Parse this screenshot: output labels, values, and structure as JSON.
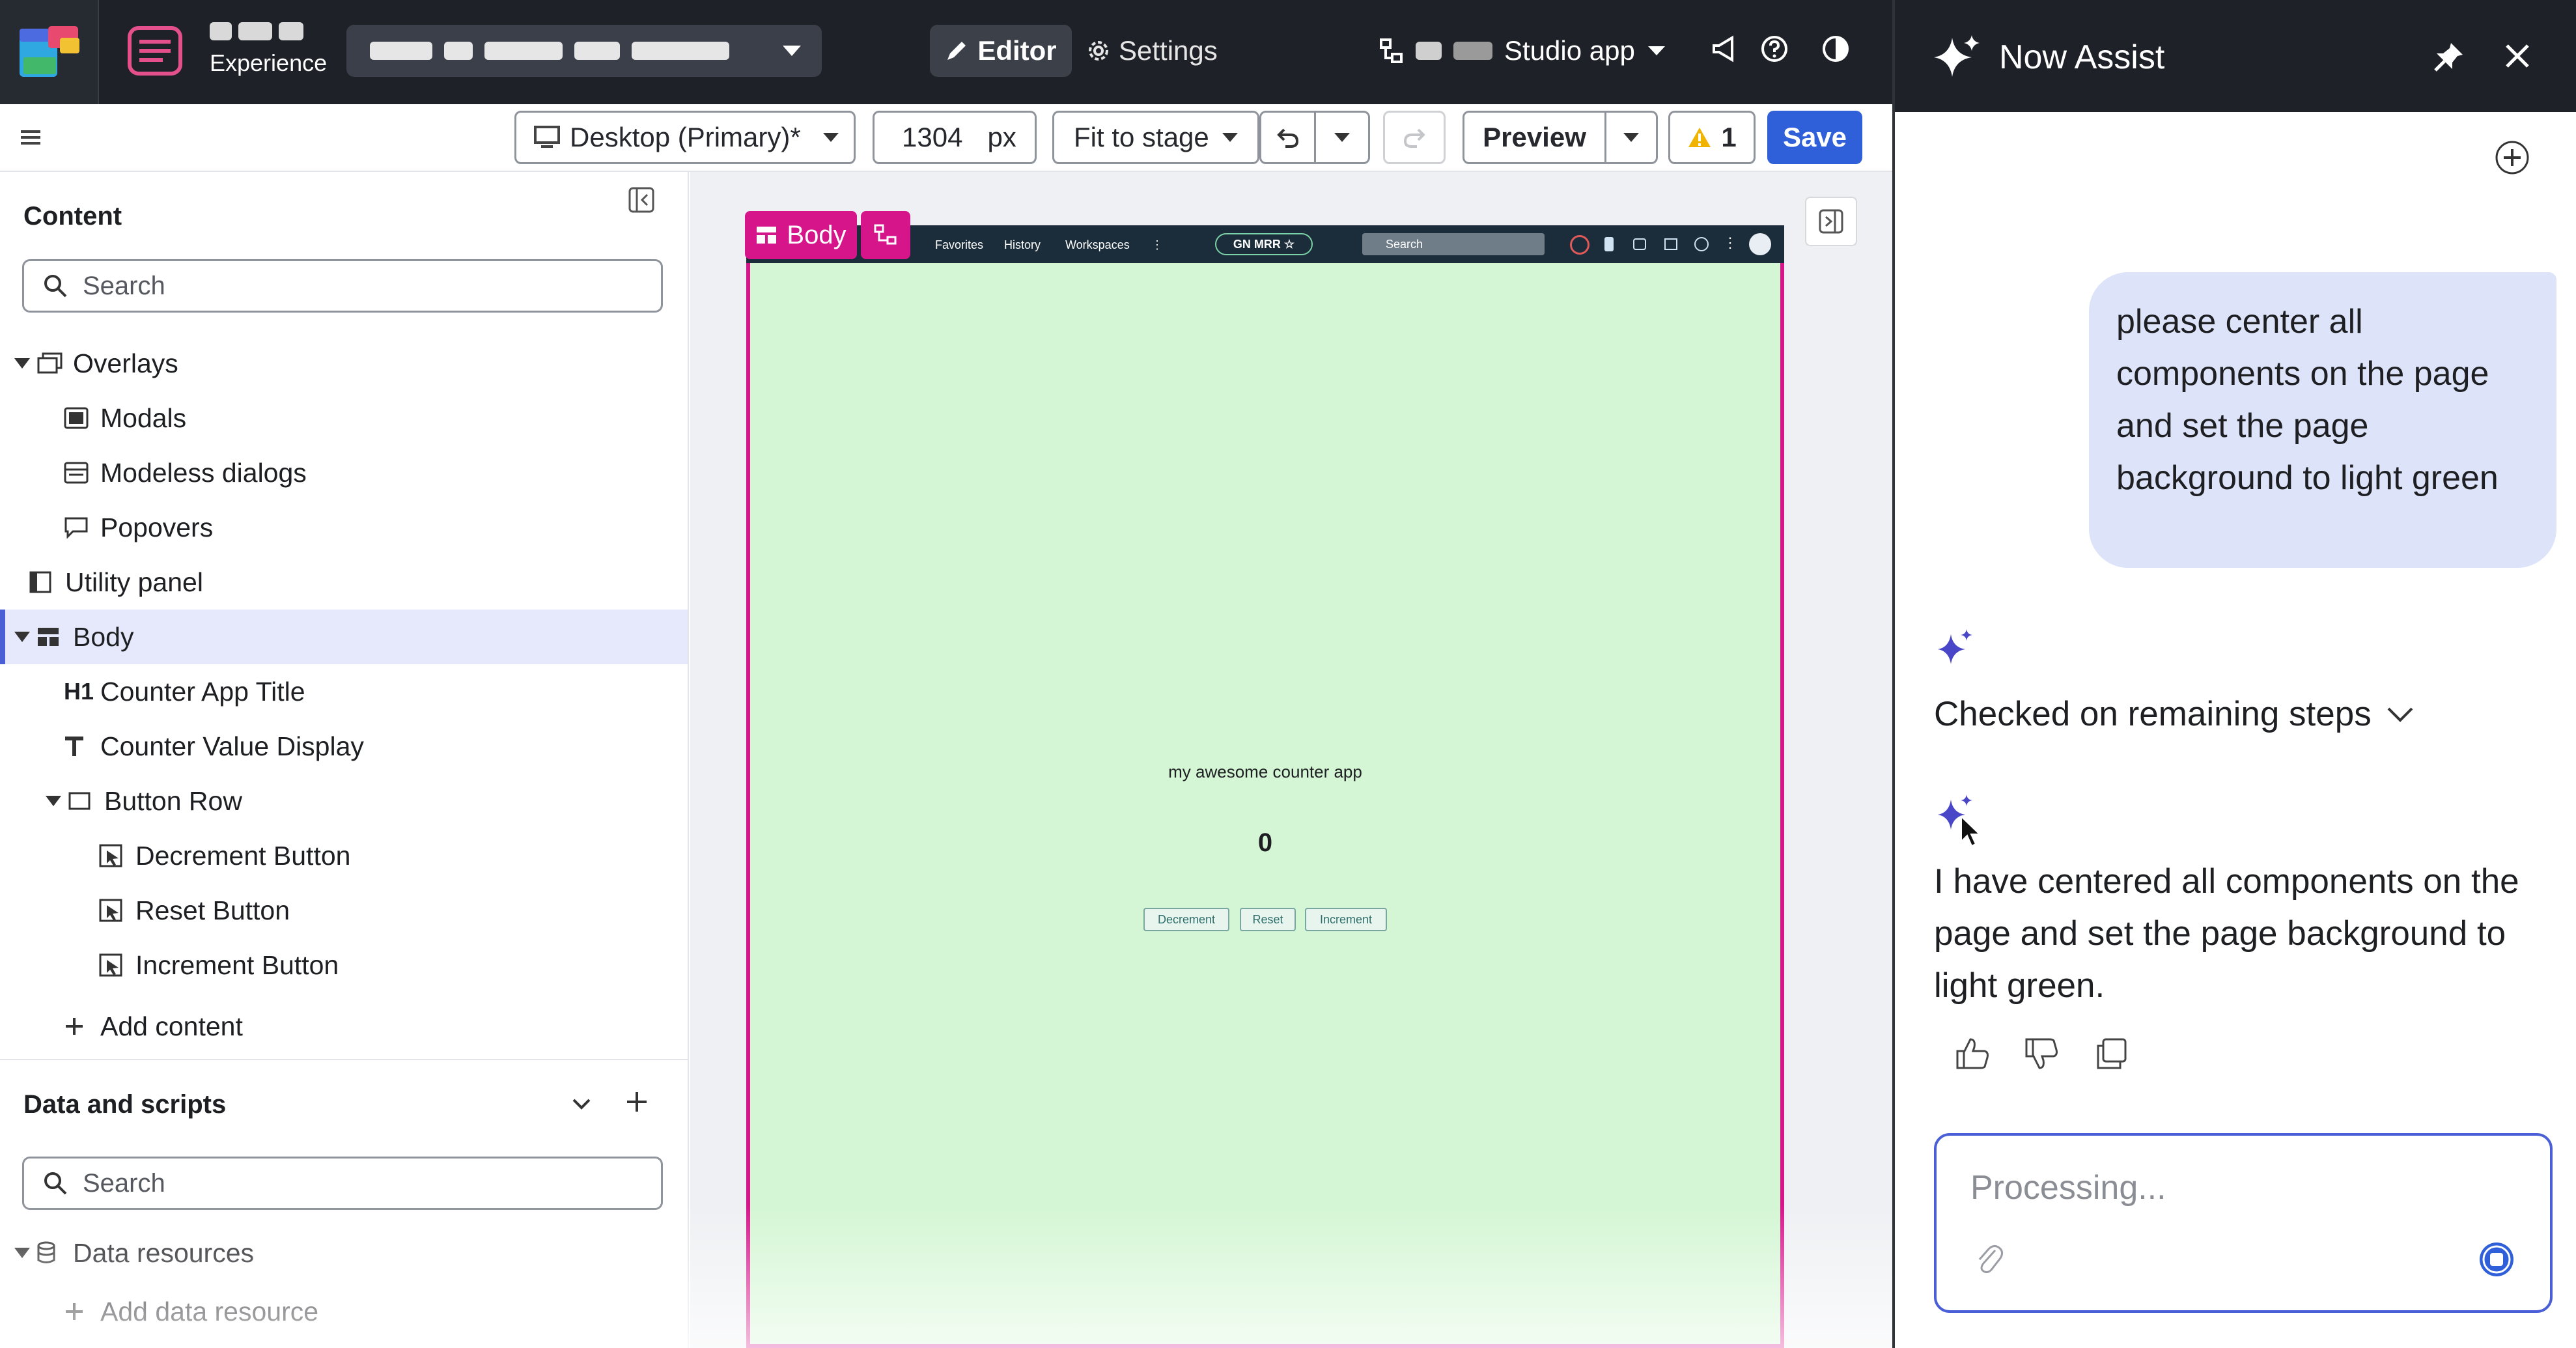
{
  "header": {
    "experience_label": "Experience",
    "editor_label": "Editor",
    "settings_label": "Settings",
    "studio_app_label": "Studio app"
  },
  "toolbar": {
    "viewport_label": "Desktop (Primary)*",
    "width_value": "1304",
    "width_unit": "px",
    "fit_label": "Fit to stage",
    "preview_label": "Preview",
    "warning_count": "1",
    "save_label": "Save"
  },
  "left_panel": {
    "content_title": "Content",
    "search_placeholder": "Search",
    "tree": [
      {
        "label": "Overlays",
        "icon": "overlays-icon"
      },
      {
        "label": "Modals",
        "icon": "modal-icon"
      },
      {
        "label": "Modeless dialogs",
        "icon": "modeless-dialog-icon"
      },
      {
        "label": "Popovers",
        "icon": "popover-icon"
      },
      {
        "label": "Utility panel",
        "icon": "panel-icon"
      },
      {
        "label": "Body",
        "icon": "layout-icon"
      },
      {
        "label": "Counter App Title",
        "icon": "heading-icon"
      },
      {
        "label": "Counter Value Display",
        "icon": "text-icon"
      },
      {
        "label": "Button Row",
        "icon": "container-icon"
      },
      {
        "label": "Decrement Button",
        "icon": "button-icon"
      },
      {
        "label": "Reset Button",
        "icon": "button-icon"
      },
      {
        "label": "Increment Button",
        "icon": "button-icon"
      }
    ],
    "add_content_label": "Add content",
    "data_scripts_title": "Data and scripts",
    "data_search_placeholder": "Search",
    "data_resources_label": "Data resources",
    "add_data_resource_label": "Add data resource"
  },
  "canvas": {
    "body_chip_label": "Body",
    "nav": {
      "favorites": "Favorites",
      "history": "History",
      "workspaces": "Workspaces",
      "more": "⋮",
      "center_pill": "GN MRR ☆",
      "search": "Search"
    },
    "counter_title": "my awesome counter app",
    "counter_value": "0",
    "buttons": {
      "decrement": "Decrement",
      "reset": "Reset",
      "increment": "Increment"
    },
    "background_color": "#d4f6d4",
    "selection_color": "#d6158a"
  },
  "assist": {
    "title": "Now Assist",
    "user_message": "please center all components on the page and set the page background to light green",
    "status_label": "Checked on remaining steps",
    "reply": "I have centered all components on the page and set the page background to light green.",
    "input_placeholder": "Processing..."
  },
  "colors": {
    "accent": "#2f5fd9",
    "header_bg": "#1e2127",
    "warning": "#f0b400",
    "assist_spark": "#4a46c8"
  }
}
